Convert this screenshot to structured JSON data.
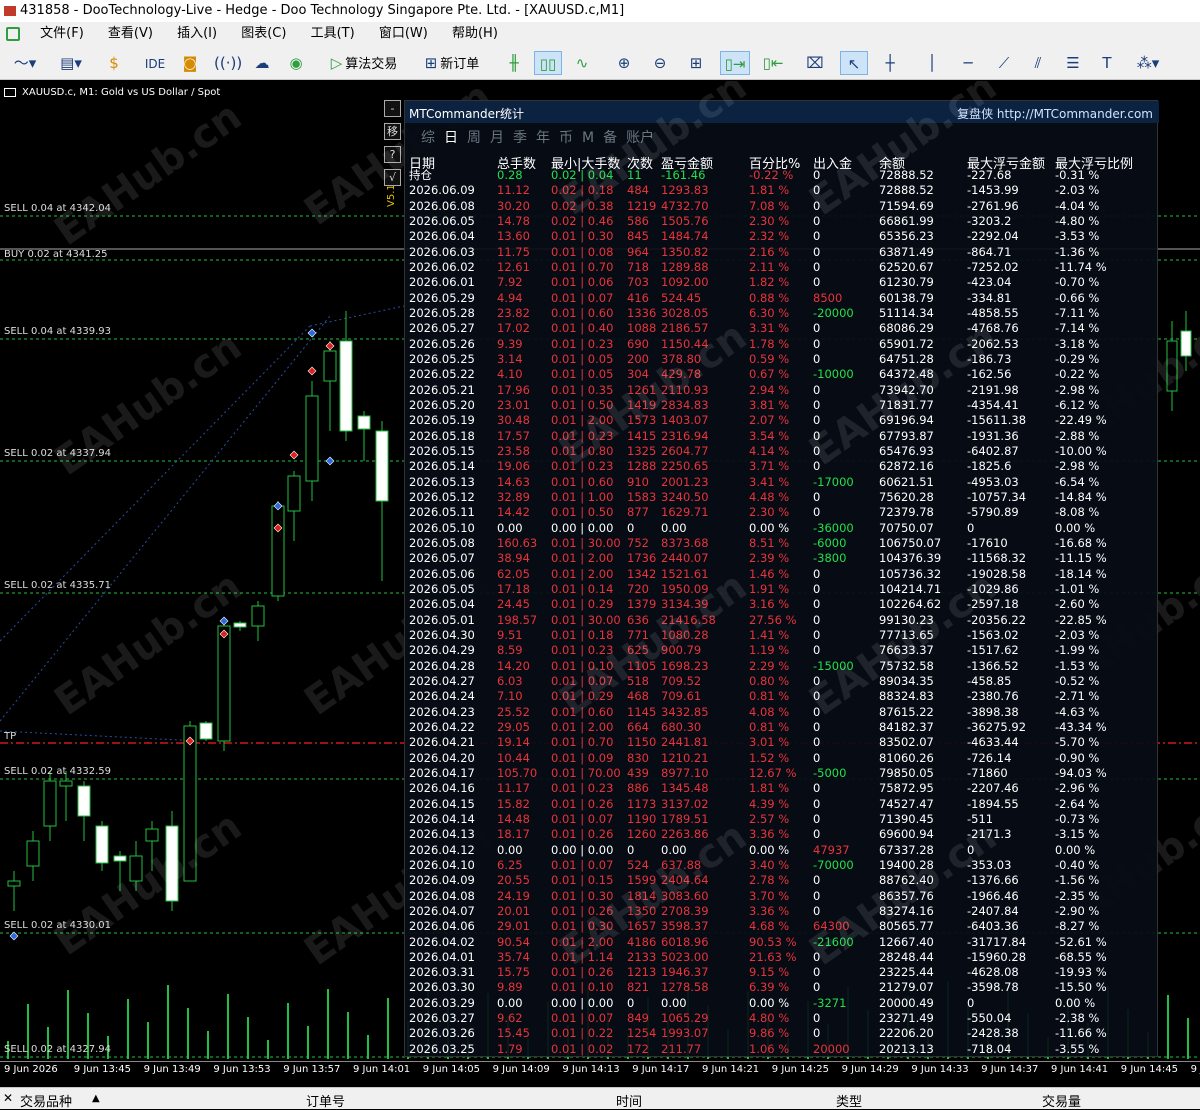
{
  "window": {
    "title": "431858 - DooTechnology-Live - Hedge - Doo Technology Singapore Pte. Ltd. - [XAUUSD.c,M1]"
  },
  "menu": [
    "文件(F)",
    "查看(V)",
    "插入(I)",
    "图表(C)",
    "工具(T)",
    "窗口(W)",
    "帮助(H)"
  ],
  "toolbar": {
    "ide_label": "IDE",
    "algo_label": "算法交易",
    "new_order_label": "新订单"
  },
  "chart": {
    "symbol_label": "XAUUSD.c, M1:  Gold vs US Dollar / Spot",
    "version_label": "V5.16",
    "tp_label": "TP",
    "order_lines": [
      "SELL 0.04 at 4342.04",
      "BUY 0.02 at 4341.25",
      "SELL 0.04 at 4339.93",
      "SELL 0.02 at 4337.94",
      "SELL 0.02 at 4335.71",
      "SELL 0.02 at 4332.59",
      "SELL 0.02 at 4330.01",
      "SELL 0.02 at 4327.94"
    ],
    "side_buttons": [
      "-",
      "移",
      "?",
      "√"
    ],
    "time_ticks": [
      "9 Jun 2026",
      "9 Jun 13:45",
      "9 Jun 13:49",
      "9 Jun 13:53",
      "9 Jun 13:57",
      "9 Jun 14:01",
      "9 Jun 14:05",
      "9 Jun 14:09",
      "9 Jun 14:13",
      "9 Jun 14:17",
      "9 Jun 14:21",
      "9 Jun 14:25",
      "9 Jun 14:29",
      "9 Jun 14:33",
      "9 Jun 14:37",
      "9 Jun 14:41",
      "9 Jun 14:45",
      "9 Jun 1"
    ],
    "watermark": "EAHub.cn"
  },
  "panel": {
    "title": "MTCommander统计",
    "site": "复盘侠 http://MTCommander.com",
    "tabs": [
      "综",
      "日",
      "周",
      "月",
      "季",
      "年",
      "币",
      "M",
      "备",
      "账户"
    ],
    "active_tab": "日",
    "headers": [
      "日期",
      "总手数",
      "最小|大手数",
      "次数",
      "盈亏金额",
      "百分比%",
      "出入金",
      "余额",
      "最大浮亏金额",
      "最大浮亏比例"
    ],
    "holding": [
      "持仓",
      "0.28",
      "0.02 | 0.04",
      "11",
      "-161.46",
      "-0.22 %",
      "0",
      "72888.52",
      "-227.68",
      "-0.31 %"
    ],
    "rows": [
      [
        "2026.06.09",
        "11.12",
        "0.02 | 0.18",
        "484",
        "1293.83",
        "1.81 %",
        "0",
        "72888.52",
        "-1453.99",
        "-2.03 %"
      ],
      [
        "2026.06.08",
        "30.20",
        "0.02 | 0.38",
        "1219",
        "4732.70",
        "7.08 %",
        "0",
        "71594.69",
        "-2761.96",
        "-4.04 %"
      ],
      [
        "2026.06.05",
        "14.78",
        "0.02 | 0.46",
        "586",
        "1505.76",
        "2.30 %",
        "0",
        "66861.99",
        "-3203.2",
        "-4.80 %"
      ],
      [
        "2026.06.04",
        "13.60",
        "0.01 | 0.30",
        "845",
        "1484.74",
        "2.32 %",
        "0",
        "65356.23",
        "-2292.04",
        "-3.53 %"
      ],
      [
        "2026.06.03",
        "11.75",
        "0.01 | 0.08",
        "964",
        "1350.82",
        "2.16 %",
        "0",
        "63871.49",
        "-864.71",
        "-1.36 %"
      ],
      [
        "2026.06.02",
        "12.61",
        "0.01 | 0.70",
        "718",
        "1289.88",
        "2.11 %",
        "0",
        "62520.67",
        "-7252.02",
        "-11.74 %"
      ],
      [
        "2026.06.01",
        "7.92",
        "0.01 | 0.06",
        "703",
        "1092.00",
        "1.82 %",
        "0",
        "61230.79",
        "-423.04",
        "-0.70 %"
      ],
      [
        "2026.05.29",
        "4.94",
        "0.01 | 0.07",
        "416",
        "524.45",
        "0.88 %",
        "8500",
        "60138.79",
        "-334.81",
        "-0.66 %"
      ],
      [
        "2026.05.28",
        "23.82",
        "0.01 | 0.60",
        "1336",
        "3028.05",
        "6.30 %",
        "-20000",
        "51114.34",
        "-4858.55",
        "-7.11 %"
      ],
      [
        "2026.05.27",
        "17.02",
        "0.01 | 0.40",
        "1088",
        "2186.57",
        "3.31 %",
        "0",
        "68086.29",
        "-4768.76",
        "-7.14 %"
      ],
      [
        "2026.05.26",
        "9.39",
        "0.01 | 0.23",
        "690",
        "1150.44",
        "1.78 %",
        "0",
        "65901.72",
        "-2062.53",
        "-3.18 %"
      ],
      [
        "2026.05.25",
        "3.14",
        "0.01 | 0.05",
        "200",
        "378.80",
        "0.59 %",
        "0",
        "64751.28",
        "-186.73",
        "-0.29 %"
      ],
      [
        "2026.05.22",
        "4.10",
        "0.01 | 0.05",
        "304",
        "429.78",
        "0.67 %",
        "-10000",
        "64372.48",
        "-162.56",
        "-0.22 %"
      ],
      [
        "2026.05.21",
        "17.96",
        "0.01 | 0.35",
        "1261",
        "2110.93",
        "2.94 %",
        "0",
        "73942.70",
        "-2191.98",
        "-2.98 %"
      ],
      [
        "2026.05.20",
        "23.01",
        "0.01 | 0.50",
        "1419",
        "2834.83",
        "3.81 %",
        "0",
        "71831.77",
        "-4354.41",
        "-6.12 %"
      ],
      [
        "2026.05.19",
        "30.48",
        "0.01 | 2.00",
        "1573",
        "1403.07",
        "2.07 %",
        "0",
        "69196.94",
        "-15611.38",
        "-22.49 %"
      ],
      [
        "2026.05.18",
        "17.57",
        "0.01 | 0.23",
        "1415",
        "2316.94",
        "3.54 %",
        "0",
        "67793.87",
        "-1931.36",
        "-2.88 %"
      ],
      [
        "2026.05.15",
        "23.58",
        "0.01 | 0.80",
        "1325",
        "2604.77",
        "4.14 %",
        "0",
        "65476.93",
        "-6402.87",
        "-10.00 %"
      ],
      [
        "2026.05.14",
        "19.06",
        "0.01 | 0.23",
        "1288",
        "2250.65",
        "3.71 %",
        "0",
        "62872.16",
        "-1825.6",
        "-2.98 %"
      ],
      [
        "2026.05.13",
        "14.63",
        "0.01 | 0.60",
        "910",
        "2001.23",
        "3.41 %",
        "-17000",
        "60621.51",
        "-4953.03",
        "-6.54 %"
      ],
      [
        "2026.05.12",
        "32.89",
        "0.01 | 1.00",
        "1583",
        "3240.50",
        "4.48 %",
        "0",
        "75620.28",
        "-10757.34",
        "-14.84 %"
      ],
      [
        "2026.05.11",
        "14.42",
        "0.01 | 0.50",
        "877",
        "1629.71",
        "2.30 %",
        "0",
        "72379.78",
        "-5790.89",
        "-8.08 %"
      ],
      [
        "2026.05.10",
        "0.00",
        "0.00 | 0.00",
        "0",
        "0.00",
        "0.00 %",
        "-36000",
        "70750.07",
        "0",
        "0.00 %"
      ],
      [
        "2026.05.08",
        "160.63",
        "0.01 | 30.00",
        "752",
        "8373.68",
        "8.51 %",
        "-6000",
        "106750.07",
        "-17610",
        "-16.68 %"
      ],
      [
        "2026.05.07",
        "38.94",
        "0.01 | 2.00",
        "1736",
        "2440.07",
        "2.39 %",
        "-3800",
        "104376.39",
        "-11568.32",
        "-11.15 %"
      ],
      [
        "2026.05.06",
        "62.05",
        "0.01 | 2.00",
        "1342",
        "1521.61",
        "1.46 %",
        "0",
        "105736.32",
        "-19028.58",
        "-18.14 %"
      ],
      [
        "2026.05.05",
        "17.18",
        "0.01 | 0.14",
        "720",
        "1950.09",
        "1.91 %",
        "0",
        "104214.71",
        "-1029.86",
        "-1.01 %"
      ],
      [
        "2026.05.04",
        "24.45",
        "0.01 | 0.29",
        "1379",
        "3134.39",
        "3.16 %",
        "0",
        "102264.62",
        "-2597.18",
        "-2.60 %"
      ],
      [
        "2026.05.01",
        "198.57",
        "0.01 | 30.00",
        "636",
        "21416.58",
        "27.56 %",
        "0",
        "99130.23",
        "-20356.22",
        "-22.85 %"
      ],
      [
        "2026.04.30",
        "9.51",
        "0.01 | 0.18",
        "771",
        "1080.28",
        "1.41 %",
        "0",
        "77713.65",
        "-1563.02",
        "-2.03 %"
      ],
      [
        "2026.04.29",
        "8.59",
        "0.01 | 0.23",
        "625",
        "900.79",
        "1.19 %",
        "0",
        "76633.37",
        "-1517.62",
        "-1.99 %"
      ],
      [
        "2026.04.28",
        "14.20",
        "0.01 | 0.10",
        "1105",
        "1698.23",
        "2.29 %",
        "-15000",
        "75732.58",
        "-1366.52",
        "-1.53 %"
      ],
      [
        "2026.04.27",
        "6.03",
        "0.01 | 0.07",
        "518",
        "709.52",
        "0.80 %",
        "0",
        "89034.35",
        "-458.85",
        "-0.52 %"
      ],
      [
        "2026.04.24",
        "7.10",
        "0.01 | 0.29",
        "468",
        "709.61",
        "0.81 %",
        "0",
        "88324.83",
        "-2380.76",
        "-2.71 %"
      ],
      [
        "2026.04.23",
        "25.52",
        "0.01 | 0.60",
        "1145",
        "3432.85",
        "4.08 %",
        "0",
        "87615.22",
        "-3898.38",
        "-4.63 %"
      ],
      [
        "2026.04.22",
        "29.05",
        "0.01 | 2.00",
        "664",
        "680.30",
        "0.81 %",
        "0",
        "84182.37",
        "-36275.92",
        "-43.34 %"
      ],
      [
        "2026.04.21",
        "19.14",
        "0.01 | 0.70",
        "1150",
        "2441.81",
        "3.01 %",
        "0",
        "83502.07",
        "-4633.44",
        "-5.70 %"
      ],
      [
        "2026.04.20",
        "10.44",
        "0.01 | 0.09",
        "830",
        "1210.21",
        "1.52 %",
        "0",
        "81060.26",
        "-726.14",
        "-0.90 %"
      ],
      [
        "2026.04.17",
        "105.70",
        "0.01 | 70.00",
        "439",
        "8977.10",
        "12.67 %",
        "-5000",
        "79850.05",
        "-71860",
        "-94.03 %"
      ],
      [
        "2026.04.16",
        "11.17",
        "0.01 | 0.23",
        "886",
        "1345.48",
        "1.81 %",
        "0",
        "75872.95",
        "-2207.46",
        "-2.96 %"
      ],
      [
        "2026.04.15",
        "15.82",
        "0.01 | 0.26",
        "1173",
        "3137.02",
        "4.39 %",
        "0",
        "74527.47",
        "-1894.55",
        "-2.64 %"
      ],
      [
        "2026.04.14",
        "14.48",
        "0.01 | 0.07",
        "1190",
        "1789.51",
        "2.57 %",
        "0",
        "71390.45",
        "-511",
        "-0.73 %"
      ],
      [
        "2026.04.13",
        "18.17",
        "0.01 | 0.26",
        "1260",
        "2263.86",
        "3.36 %",
        "0",
        "69600.94",
        "-2171.3",
        "-3.15 %"
      ],
      [
        "2026.04.12",
        "0.00",
        "0.00 | 0.00",
        "0",
        "0.00",
        "0.00 %",
        "47937",
        "67337.28",
        "0",
        "0.00 %"
      ],
      [
        "2026.04.10",
        "6.25",
        "0.01 | 0.07",
        "524",
        "637.88",
        "3.40 %",
        "-70000",
        "19400.28",
        "-353.03",
        "-0.40 %"
      ],
      [
        "2026.04.09",
        "20.55",
        "0.01 | 0.15",
        "1599",
        "2404.64",
        "2.78 %",
        "0",
        "88762.40",
        "-1376.66",
        "-1.56 %"
      ],
      [
        "2026.04.08",
        "24.19",
        "0.01 | 0.30",
        "1814",
        "3083.60",
        "3.70 %",
        "0",
        "86357.76",
        "-1966.46",
        "-2.35 %"
      ],
      [
        "2026.04.07",
        "20.01",
        "0.01 | 0.26",
        "1350",
        "2708.39",
        "3.36 %",
        "0",
        "83274.16",
        "-2407.84",
        "-2.90 %"
      ],
      [
        "2026.04.06",
        "29.01",
        "0.01 | 0.30",
        "1657",
        "3598.37",
        "4.68 %",
        "64300",
        "80565.77",
        "-6403.36",
        "-8.27 %"
      ],
      [
        "2026.04.02",
        "90.54",
        "0.01 | 2.00",
        "4186",
        "6018.96",
        "90.53 %",
        "-21600",
        "12667.40",
        "-31717.84",
        "-52.61 %"
      ],
      [
        "2026.04.01",
        "35.74",
        "0.01 | 1.14",
        "2133",
        "5023.00",
        "21.63 %",
        "0",
        "28248.44",
        "-15960.28",
        "-68.55 %"
      ],
      [
        "2026.03.31",
        "15.75",
        "0.01 | 0.26",
        "1213",
        "1946.37",
        "9.15 %",
        "0",
        "23225.44",
        "-4628.08",
        "-19.93 %"
      ],
      [
        "2026.03.30",
        "9.89",
        "0.01 | 0.10",
        "821",
        "1278.58",
        "6.39 %",
        "0",
        "21279.07",
        "-3598.78",
        "-15.50 %"
      ],
      [
        "2026.03.29",
        "0.00",
        "0.00 | 0.00",
        "0",
        "0.00",
        "0.00 %",
        "-3271",
        "20000.49",
        "0",
        "0.00 %"
      ],
      [
        "2026.03.27",
        "9.62",
        "0.01 | 0.07",
        "849",
        "1065.29",
        "4.80 %",
        "0",
        "23271.49",
        "-550.04",
        "-2.38 %"
      ],
      [
        "2026.03.26",
        "15.45",
        "0.01 | 0.22",
        "1254",
        "1993.07",
        "9.86 %",
        "0",
        "22206.20",
        "-2428.38",
        "-11.66 %"
      ],
      [
        "2026.03.25",
        "1.79",
        "0.01 | 0.02",
        "172",
        "211.77",
        "1.06 %",
        "20000",
        "20213.13",
        "-718.04",
        "-3.55 %"
      ]
    ]
  },
  "bottom": {
    "col1": "交易品种",
    "col2": "订单号",
    "col3": "时间",
    "col4": "类型",
    "col5": "交易量"
  }
}
